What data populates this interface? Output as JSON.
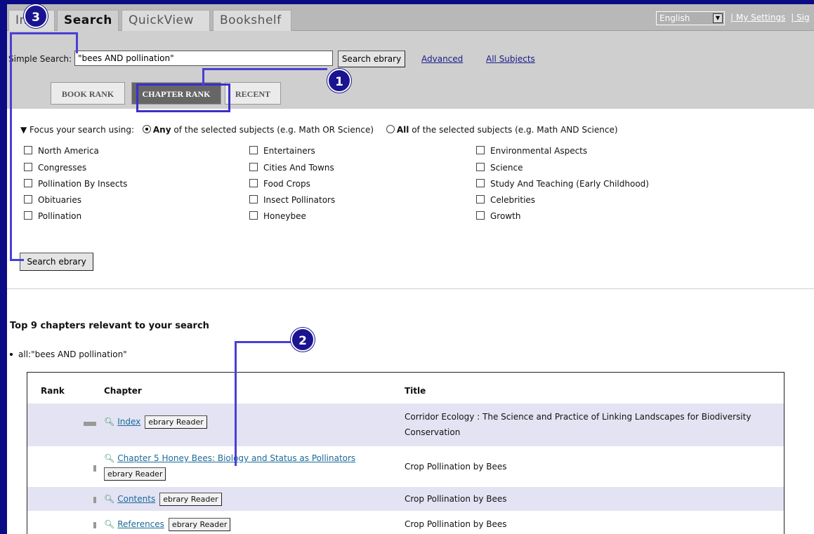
{
  "tabs": [
    {
      "label": "Info"
    },
    {
      "label": "Search"
    },
    {
      "label": "QuickView"
    },
    {
      "label": "Bookshelf"
    }
  ],
  "header": {
    "language": "English",
    "links": [
      "| My Settings",
      "| Sig"
    ]
  },
  "search": {
    "label": "Simple Search:",
    "value": "\"bees AND pollination\"",
    "button": "Search ebrary",
    "advanced": "Advanced",
    "all_subjects": "All Subjects"
  },
  "subtabs": [
    "BOOK RANK",
    "CHAPTER RANK",
    "RECENT"
  ],
  "focus": {
    "prefix": "▼ Focus your search using:",
    "any_bold": "Any",
    "any_rest": " of the selected subjects (e.g. Math OR Science)",
    "all_bold": "All",
    "all_rest": " of the selected subjects (e.g. Math AND Science)"
  },
  "subjects": [
    [
      "North America",
      "Congresses",
      "Pollination By Insects",
      "Obituaries",
      "Pollination"
    ],
    [
      "Entertainers",
      "Cities And Towns",
      "Food Crops",
      "Insect Pollinators",
      "Honeybee"
    ],
    [
      "Environmental Aspects",
      "Science",
      "Study And Teaching (Early Childhood)",
      "Celebrities",
      "Growth"
    ]
  ],
  "search_button_2": "Search ebrary",
  "results": {
    "heading": "Top 9 chapters relevant to your search",
    "query": "all:\"bees AND pollination\"",
    "columns": [
      "Rank",
      "Chapter",
      "Title"
    ],
    "reader_label": "ebrary Reader",
    "rows": [
      {
        "chapter": "Index",
        "title": "Corridor Ecology : The Science and Practice of Linking Landscapes for Biodiversity Conservation",
        "rank": 0.9
      },
      {
        "chapter": "Chapter 5 Honey Bees: Biology and Status as Pollinators",
        "title": "Crop Pollination by Bees",
        "rank": 0.2
      },
      {
        "chapter": "Contents",
        "title": "Crop Pollination by Bees",
        "rank": 0.2
      },
      {
        "chapter": "References",
        "title": "Crop Pollination by Bees",
        "rank": 0.2
      }
    ]
  },
  "annotations": [
    "1",
    "2",
    "3"
  ],
  "colors": {
    "frame": "#0b0b85",
    "annotation": "#1a1490",
    "panel": "#cfcfcf",
    "row_alt": "#e3e3f3"
  }
}
